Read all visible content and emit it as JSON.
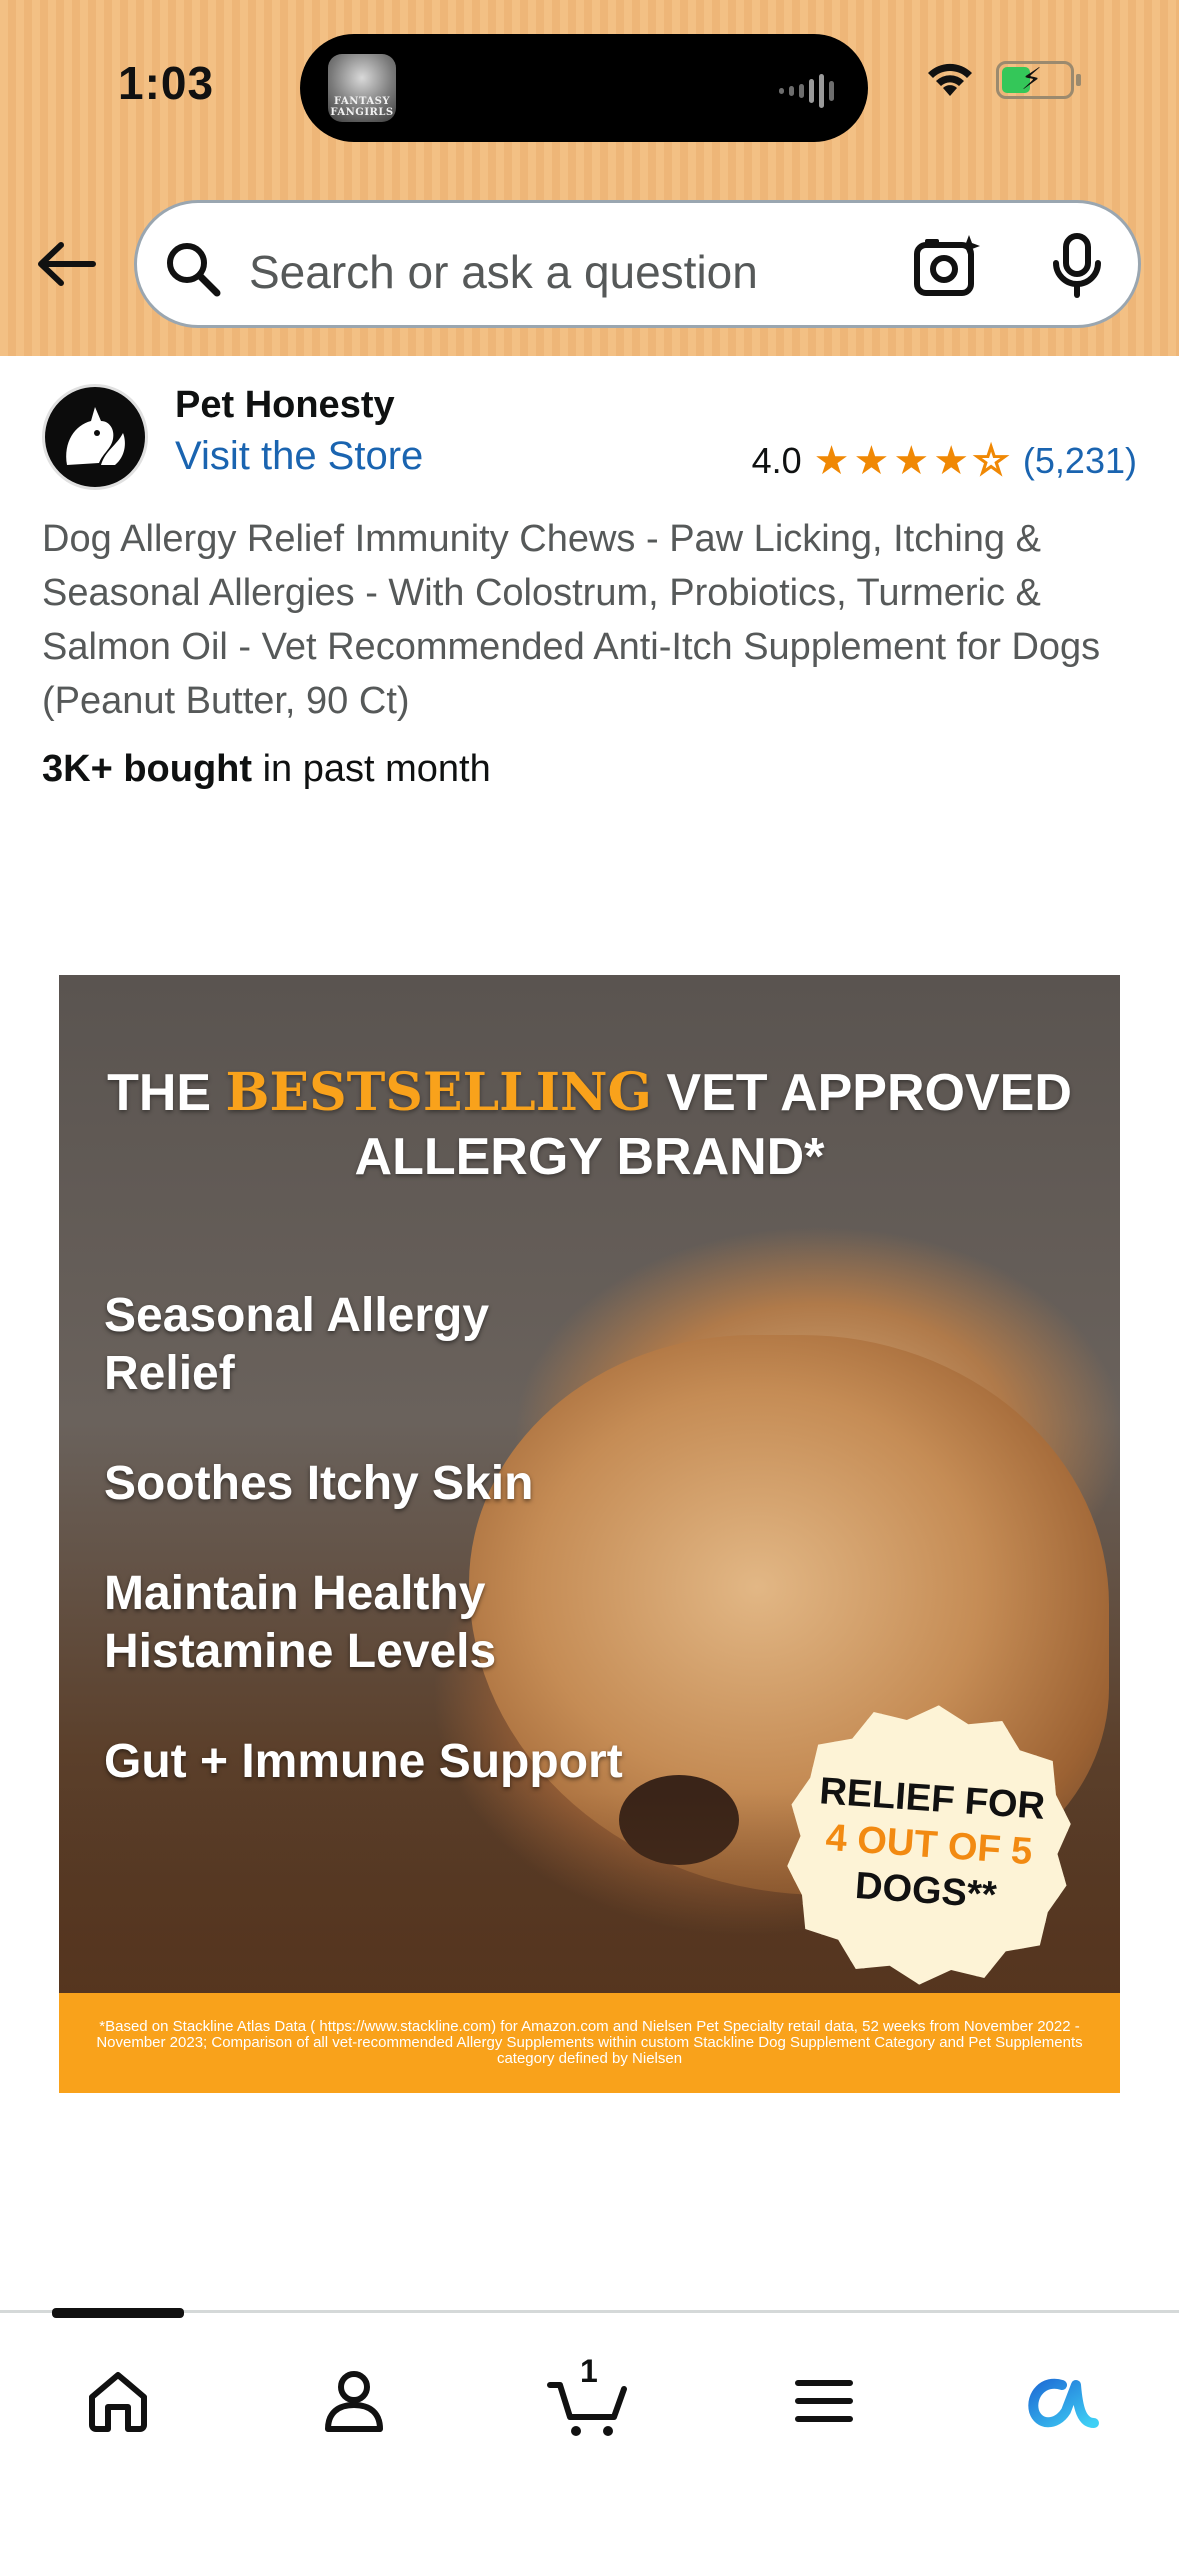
{
  "status_bar": {
    "time": "1:03",
    "island_app_label": "FANTASY FANGIRLS"
  },
  "search": {
    "placeholder": "Search or ask a question"
  },
  "product": {
    "brand_name": "Pet Honesty",
    "visit_store": "Visit the Store",
    "rating": "4.0",
    "rating_value": 4.0,
    "rating_count": "(5,231)",
    "title": "Dog Allergy Relief Immunity Chews - Paw Licking, Itching & Seasonal Allergies - With Colostrum, Probiotics, Turmeric & Salmon Oil - Vet Recommended Anti-Itch Supplement for Dogs (Peanut Butter, 90 Ct)",
    "bought_bold": "3K+ bought",
    "bought_rest": " in past month"
  },
  "image": {
    "headline_pre": "THE ",
    "headline_highlight": "BESTSELLING",
    "headline_post": " VET APPROVED ALLERGY BRAND*",
    "benefits": [
      "Seasonal Allergy Relief",
      "Soothes Itchy Skin",
      "Maintain Healthy Histamine Levels",
      "Gut + Immune Support"
    ],
    "badge_line1": "RELIEF FOR",
    "badge_line2": "4 OUT OF 5",
    "badge_line3": "DOGS**",
    "disclaimer": "*Based on Stackline Atlas Data ( https://www.stackline.com) for Amazon.com and Nielsen Pet Specialty retail data, 52 weeks from November 2022 - November 2023; Comparison of all vet-recommended Allergy Supplements within custom Stackline Dog Supplement Category and Pet Supplements category defined by Nielsen"
  },
  "bottom_nav": {
    "cart_count": "1"
  },
  "colors": {
    "header_bg": "#f3c084",
    "link_blue": "#1a64b0",
    "star_orange": "#f08804",
    "image_accent": "#f9a21b"
  },
  "icons": [
    "back-arrow-icon",
    "search-icon",
    "camera-icon",
    "mic-icon",
    "home-icon",
    "account-icon",
    "cart-icon",
    "menu-icon",
    "rufus-ai-icon"
  ]
}
